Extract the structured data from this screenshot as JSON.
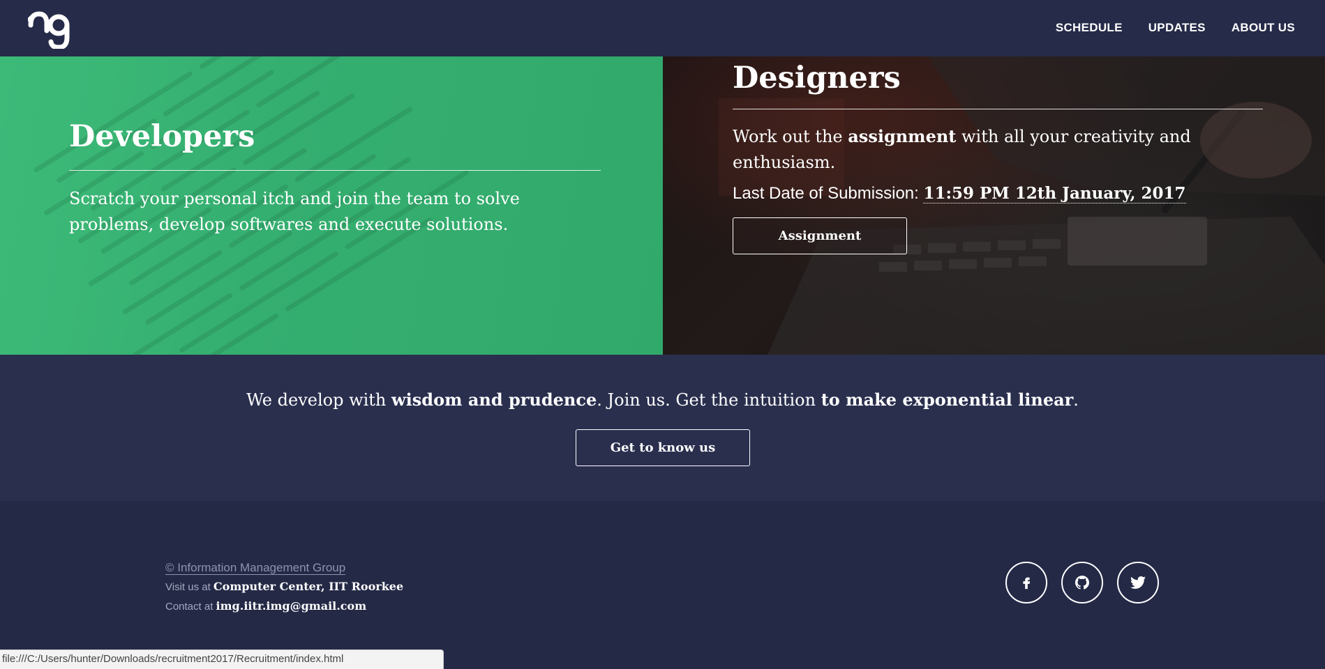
{
  "nav": {
    "logo_icon": "img-logo-icon",
    "links": [
      "SCHEDULE",
      "UPDATES",
      "ABOUT US"
    ]
  },
  "developers": {
    "title": "Developers",
    "description": "Scratch your personal itch and join the team to solve problems, develop softwares and execute solutions."
  },
  "designers": {
    "title": "Designers",
    "text_before": "Work out the ",
    "text_bold": "assignment",
    "text_after": " with all your creativity and enthusiasm.",
    "deadline_label": "Last Date of Submission: ",
    "deadline_value": "11:59 PM 12th January, 2017",
    "button_label": "Assignment"
  },
  "about": {
    "part1": "We develop with ",
    "bold1": "wisdom and prudence",
    "part2": ". Join us. Get the intuition ",
    "bold2": "to make exponential linear",
    "part3": ".",
    "button_label": "Get to know us"
  },
  "footer": {
    "copyright": "© Information Management Group",
    "visit_label": "Visit us at ",
    "visit_value": "Computer Center, IIT Roorkee",
    "contact_label": "Contact at ",
    "contact_value": "img.iitr.img@gmail.com",
    "socials": [
      "facebook-icon",
      "github-icon",
      "twitter-icon"
    ]
  },
  "status_url": "file:///C:/Users/hunter/Downloads/recruitment2017/Recruitment/index.html",
  "colors": {
    "navy": "#262b49",
    "green": "#35af70",
    "footer": "#242946"
  }
}
